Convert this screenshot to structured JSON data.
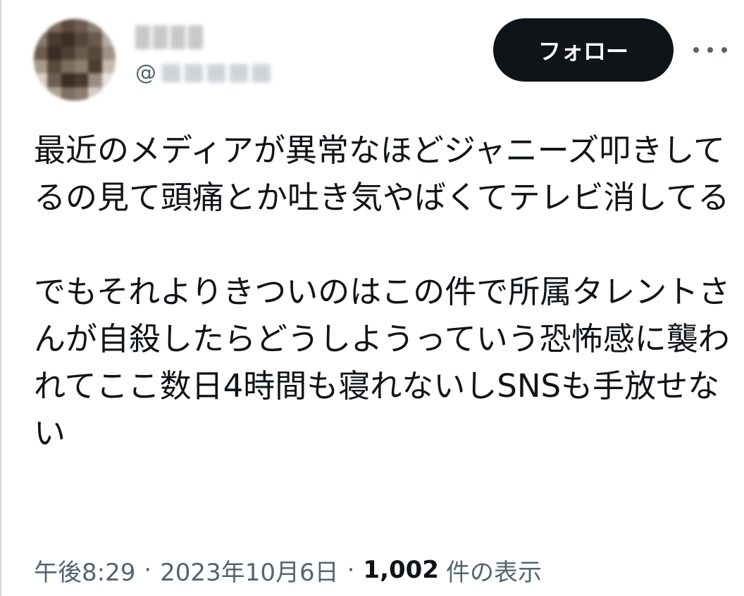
{
  "tweet": {
    "handle_prefix": "@",
    "follow_label": "フォロー",
    "more_icon": "more-horizontal-icon",
    "text_paragraph_1": "最近のメディアが異常なほどジャニーズ叩きしてるの見て頭痛とか吐き気やばくてテレビ消してる",
    "text_paragraph_2": "でもそれよりきついのはこの件で所属タレントさんが自殺したらどうしようっていう恐怖感に襲われてここ数日4時間も寝れないしSNSも手放せない",
    "time": "午後8:29",
    "separator": "·",
    "date": "2023年10月6日",
    "views_count": "1,002",
    "views_label": "件の表示"
  },
  "colors": {
    "text_primary": "#0f1419",
    "text_secondary": "#536471",
    "follow_bg": "#0f1419",
    "follow_text": "#ffffff"
  }
}
